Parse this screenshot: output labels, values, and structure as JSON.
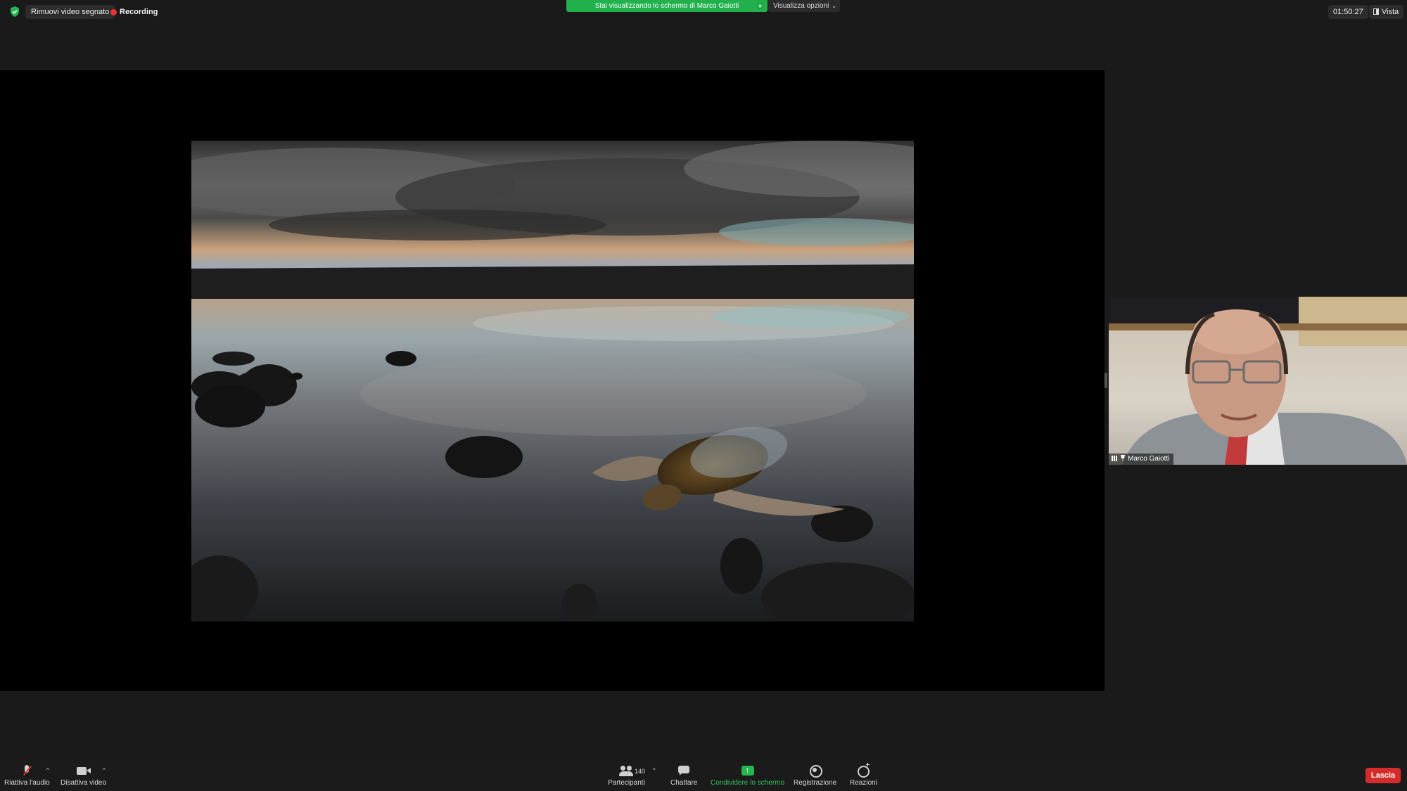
{
  "top_bar": {
    "remove_video_label": "Rimuovi video segnato",
    "recording_label": "Recording",
    "share_banner": "Stai visualizzando lo schermo di Marco Gaiotti",
    "view_options_label": "Visualizza opzioni",
    "clock": "01:50:27",
    "view_label": "Vista"
  },
  "participant": {
    "name": "Marco Gaiotti"
  },
  "toolbar": {
    "unmute_label": "Riattiva l'audio",
    "video_label": "Disattiva video",
    "participants_label": "Partecipanti",
    "participants_count": "140",
    "chat_label": "Chattare",
    "share_label": "Condividere lo schermo",
    "record_label": "Registrazione",
    "reactions_label": "Reazioni",
    "leave_label": "Lascia"
  },
  "colors": {
    "share_green": "#21b04b",
    "record_red": "#e8332e",
    "leave_red": "#d52b2b",
    "background": "#1a1a1a"
  },
  "icons": [
    "shield-icon",
    "record-dot-icon",
    "chevron-down-icon",
    "layout-icon",
    "signal-icon",
    "pin-icon",
    "microphone-muted-icon",
    "camera-icon",
    "people-icon",
    "chat-icon",
    "share-screen-icon",
    "record-icon",
    "reaction-icon"
  ]
}
